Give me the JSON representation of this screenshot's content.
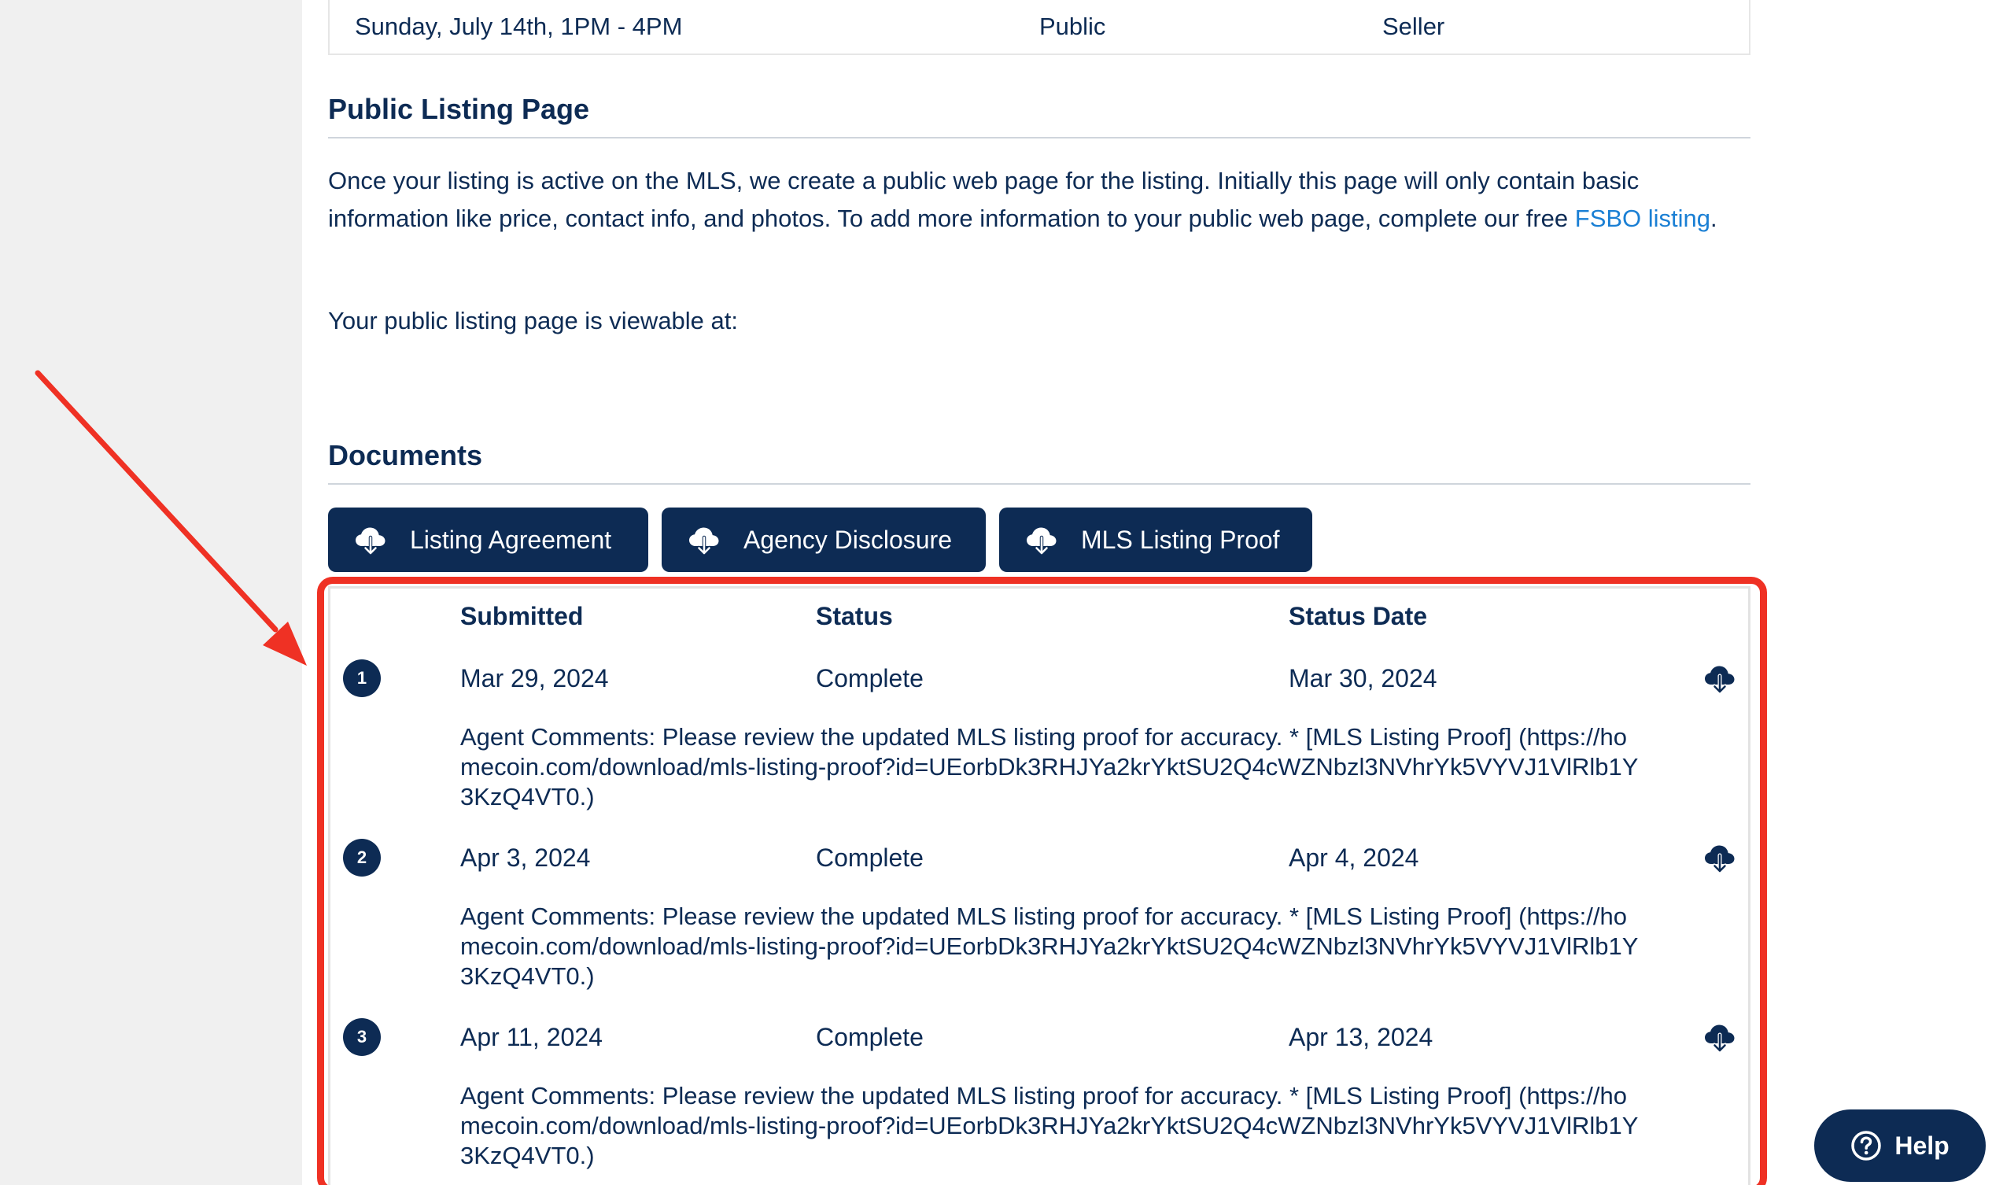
{
  "open_house": {
    "date": "Sunday, July 14th, 1PM - 4PM",
    "type": "Public",
    "by": "Seller"
  },
  "public_listing": {
    "title": "Public Listing Page",
    "body_text": "Once your listing is active on the MLS, we create a public web page for the listing. Initially this page will only contain basic information like price, contact info, and photos. To add more information to your public web page, complete our free ",
    "link_text": "FSBO listing",
    "body_end": ".",
    "viewable_text": "Your public listing page is viewable at:"
  },
  "documents": {
    "title": "Documents",
    "buttons": [
      {
        "label": "Listing Agreement",
        "icon": "cloud-download-icon"
      },
      {
        "label": "Agency Disclosure",
        "icon": "cloud-download-icon"
      },
      {
        "label": "MLS Listing Proof",
        "icon": "cloud-download-icon"
      }
    ],
    "history": {
      "headers": {
        "submitted": "Submitted",
        "status": "Status",
        "status_date": "Status Date"
      },
      "entries": [
        {
          "num": "1",
          "submitted": "Mar 29, 2024",
          "status": "Complete",
          "status_date": "Mar 30, 2024",
          "comment": "Agent Comments: Please review the updated MLS listing proof for accuracy. * [MLS Listing Proof] (https://homecoin.com/download/mls-listing-proof?id=UEorbDk3RHJYa2krYktSU2Q4cWZNbzl3NVhrYk5VYVJ1VlRlb1Y3KzQ4VT0.)"
        },
        {
          "num": "2",
          "submitted": "Apr 3, 2024",
          "status": "Complete",
          "status_date": "Apr 4, 2024",
          "comment": "Agent Comments: Please review the updated MLS listing proof for accuracy. * [MLS Listing Proof] (https://homecoin.com/download/mls-listing-proof?id=UEorbDk3RHJYa2krYktSU2Q4cWZNbzl3NVhrYk5VYVJ1VlRlb1Y3KzQ4VT0.)"
        },
        {
          "num": "3",
          "submitted": "Apr 11, 2024",
          "status": "Complete",
          "status_date": "Apr 13, 2024",
          "comment": "Agent Comments: Please review the updated MLS listing proof for accuracy. * [MLS Listing Proof] (https://homecoin.com/download/mls-listing-proof?id=UEorbDk3RHJYa2krYktSU2Q4cWZNbzl3NVhrYk5VYVJ1VlRlb1Y3KzQ4VT0.)"
        }
      ]
    }
  },
  "help": {
    "label": "Help",
    "icon": "question-circle-icon"
  },
  "colors": {
    "navy": "#0d2b54",
    "link": "#1a7fd4",
    "annotation_red": "#ef3124",
    "sidebar": "#f0f0f0"
  }
}
